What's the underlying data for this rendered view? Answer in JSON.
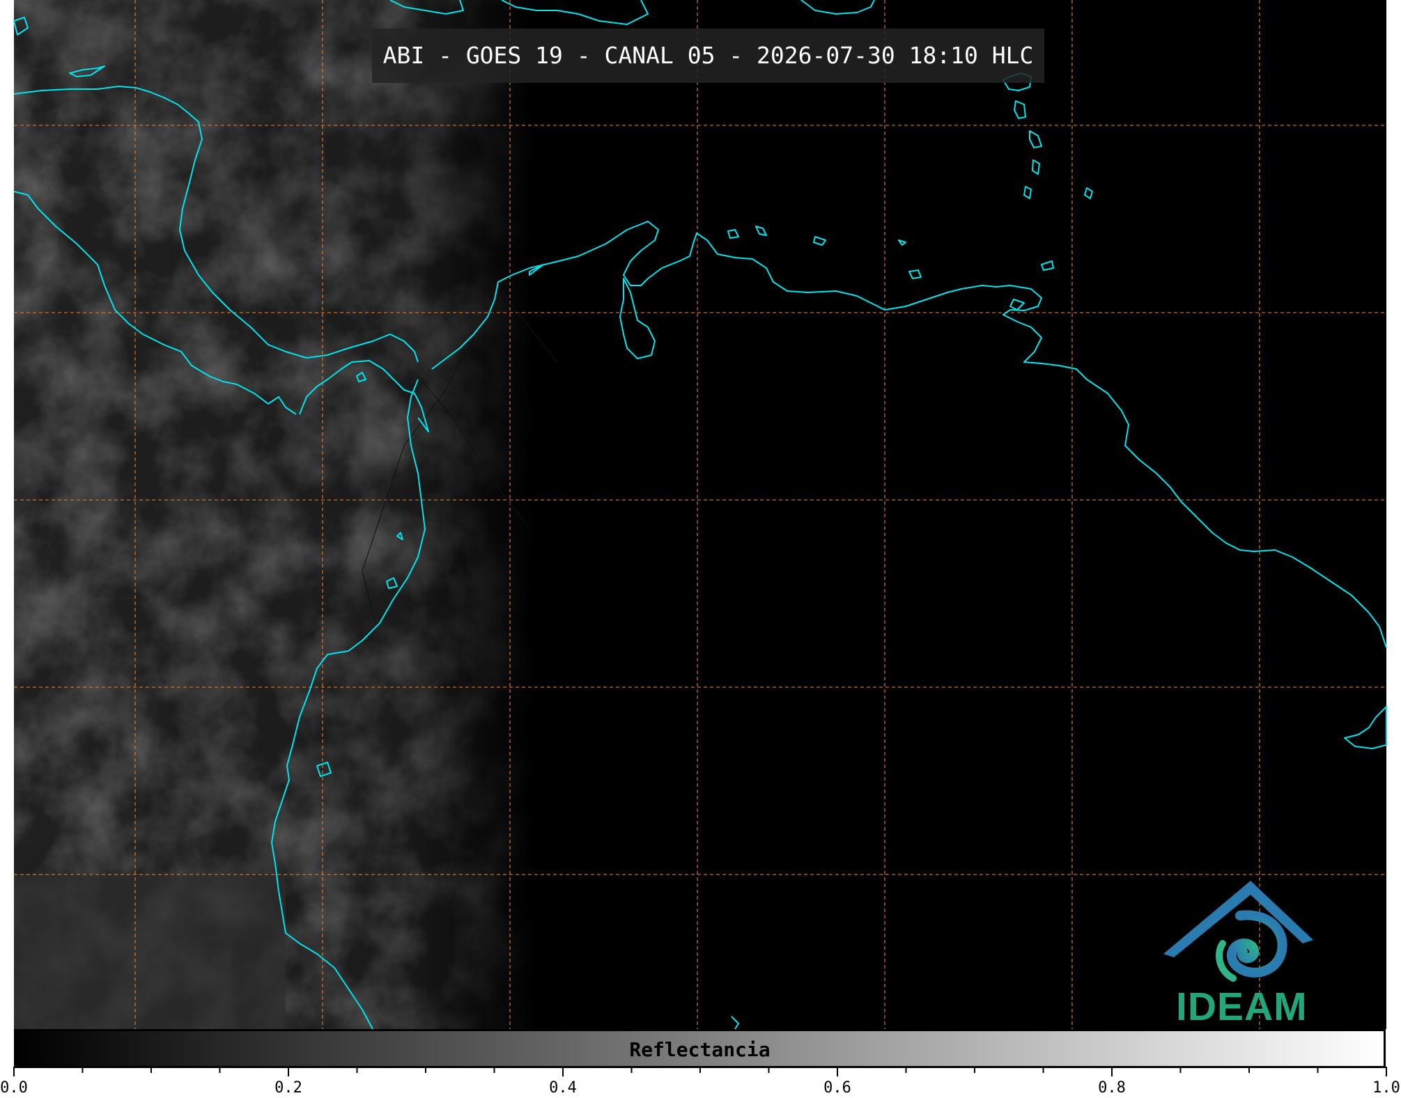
{
  "title": "ABI - GOES 19 - CANAL 05 - 2026-07-30 18:10 HLC",
  "colorbar": {
    "label": "Reflectancia",
    "ticks": [
      "0.0",
      "0.2",
      "0.4",
      "0.6",
      "0.8",
      "1.0"
    ],
    "range": [
      0.0,
      1.0
    ],
    "colors": [
      "#000000",
      "#ffffff"
    ]
  },
  "logo": {
    "text": "IDEAM",
    "colors": [
      "#2b6ea8",
      "#22a67a"
    ]
  },
  "map": {
    "coastline_color": "#00e5ee",
    "grid_color": "#e07a2a",
    "grid_style": "dashed",
    "background_color": "#000000"
  }
}
